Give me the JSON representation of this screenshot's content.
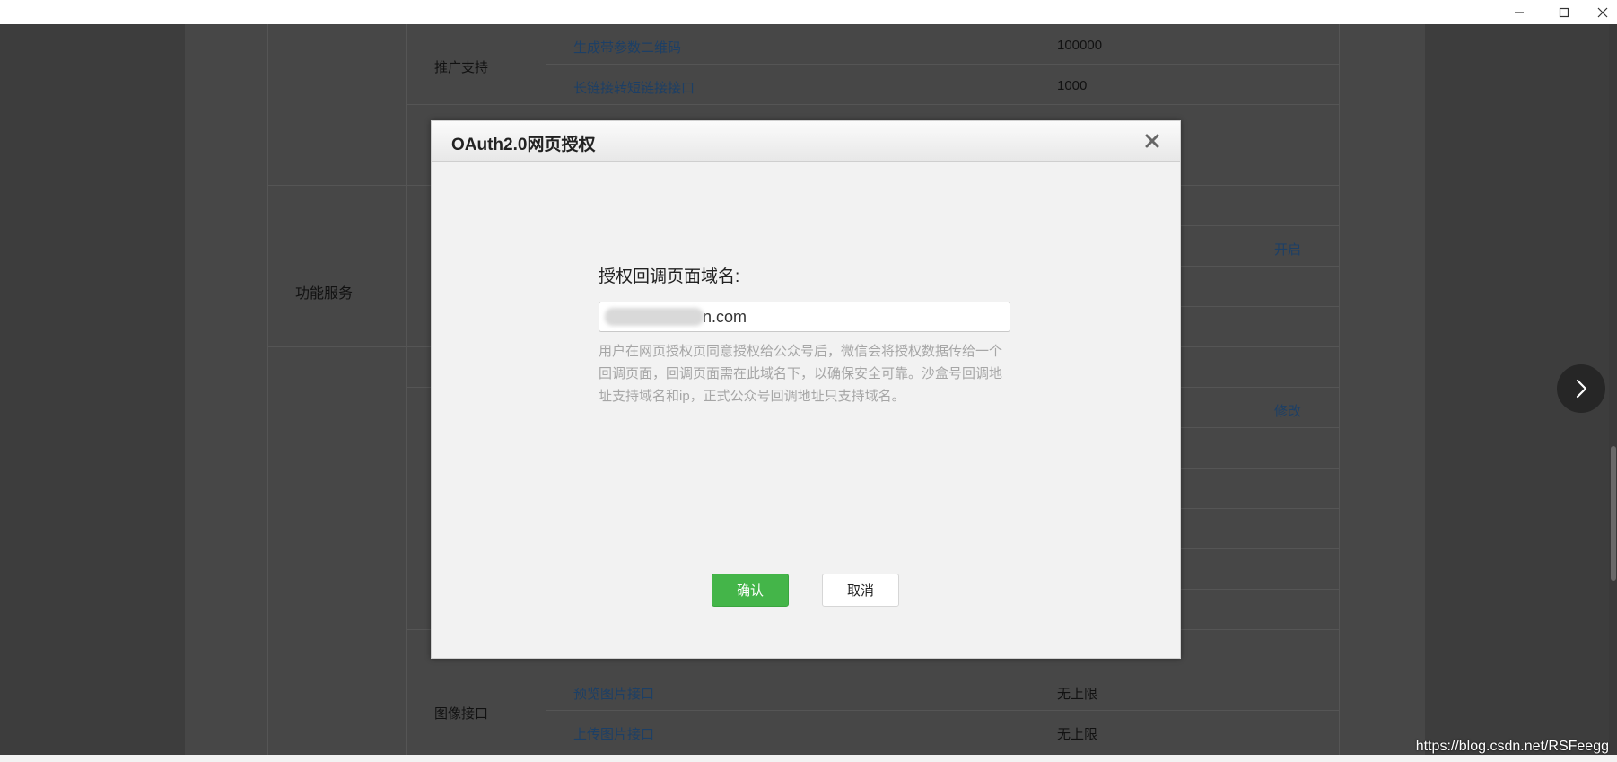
{
  "background_table": {
    "categories": [
      {
        "label": "功能服务"
      }
    ],
    "subcategories": [
      {
        "label": "推广支持"
      },
      {
        "label": "图像接口"
      }
    ],
    "rows": [
      {
        "name": "生成带参数二维码",
        "value": "100000"
      },
      {
        "name": "长链接转短链接接口",
        "value": "1000"
      },
      {
        "name": "预览图片接口",
        "value": "无上限"
      },
      {
        "name": "上传图片接口",
        "value": "无上限"
      }
    ],
    "actions": [
      {
        "label": "开启"
      },
      {
        "label": "修改"
      }
    ]
  },
  "dialog": {
    "title": "OAuth2.0网页授权",
    "field_label": "授权回调页面域名:",
    "field_value": "n.com",
    "help_text": "用户在网页授权页同意授权给公众号后，微信会将授权数据传给一个回调页面，回调页面需在此域名下，以确保安全可靠。沙盒号回调地址支持域名和ip，正式公众号回调地址只支持域名。",
    "confirm_label": "确认",
    "cancel_label": "取消"
  },
  "watermark": "https://blog.csdn.net/RSFeegg",
  "icons": {
    "close": "close-icon",
    "next": "chevron-right-icon",
    "minimize": "minimize-icon",
    "maximize": "maximize-icon",
    "window_close": "window-close-icon"
  },
  "colors": {
    "primary_button": "#44b549",
    "overlay": "#474747",
    "link": "#1c3f66"
  }
}
